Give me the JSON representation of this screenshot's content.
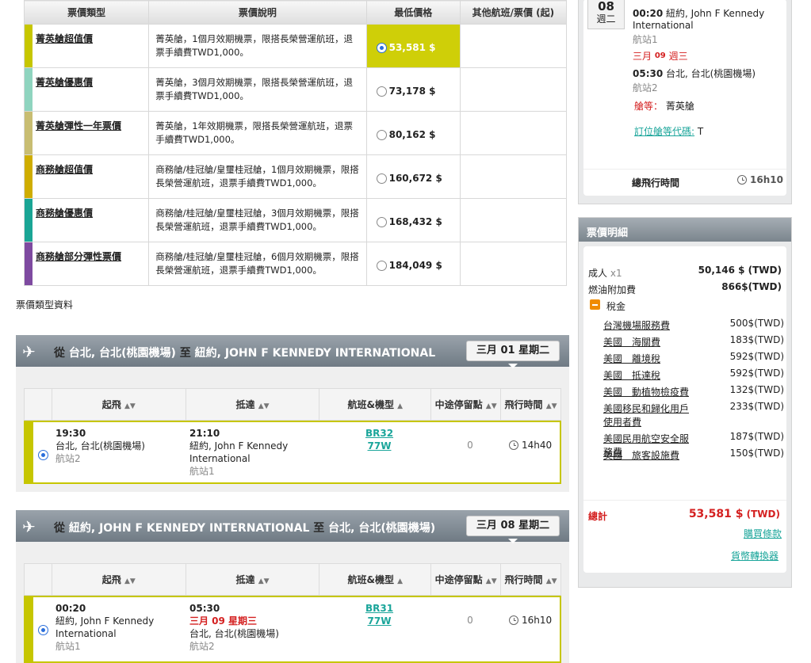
{
  "fare_table": {
    "headers": [
      "票價類型",
      "票價說明",
      "最低價格",
      "其他航班/票價 (起)"
    ],
    "rows": [
      {
        "name": "菁英艙超值價",
        "desc": "菁英艙，1個月效期機票，限搭長榮營運航班，退票手續費TWD1,000。",
        "price": "53,581 $",
        "color": "#c6c600",
        "selected": true
      },
      {
        "name": "菁英艙優惠價",
        "desc": "菁英艙，3個月效期機票，限搭長榮營運航班，退票手續費TWD1,000。",
        "price": "73,178 $",
        "color": "#8fd4bf",
        "selected": false
      },
      {
        "name": "菁英艙彈性一年票價",
        "desc": "菁英艙，1年效期機票，限搭長榮營運航班，退票手續費TWD1,000。",
        "price": "80,162 $",
        "color": "#c8bd72",
        "selected": false
      },
      {
        "name": "商務艙超值價",
        "desc": "商務艙/桂冠艙/皇璽桂冠艙，1個月效期機票，限搭長榮營運航班，退票手續費TWD1,000。",
        "price": "160,672 $",
        "color": "#cfad00",
        "selected": false
      },
      {
        "name": "商務艙優惠價",
        "desc": "商務艙/桂冠艙/皇璽桂冠艙，3個月效期機票，限搭長榮營運航班，退票手續費TWD1,000。",
        "price": "168,432 $",
        "color": "#1aa595",
        "selected": false
      },
      {
        "name": "商務艙部分彈性票價",
        "desc": "商務艙/桂冠艙/皇璽桂冠艙，6個月效期機票，限搭長榮營運航班，退票手續費TWD1,000。",
        "price": "184,049 $",
        "color": "#7e4aa0",
        "selected": false
      }
    ],
    "footnote": "票價類型資料"
  },
  "flight_headers": [
    "起飛",
    "抵達",
    "航班&機型",
    "中途停留點",
    "飛行時間"
  ],
  "outbound": {
    "from_label": "從",
    "from": "台北, 台北(桃園機場)",
    "to_label": "至",
    "to": "紐約, JOHN F KENNEDY INTERNATIONAL",
    "date": "三月 01 星期二",
    "dep_time": "19:30",
    "dep_city": "台北, 台北(桃園機場)",
    "dep_terminal": "航站2",
    "arr_time": "21:10",
    "arr_city": "紐約, John F Kennedy International",
    "arr_terminal": "航站1",
    "flight_no": "BR32",
    "aircraft": "77W",
    "stops": "0",
    "duration": "14h40"
  },
  "inbound": {
    "from_label": "從",
    "from": "紐約, JOHN F KENNEDY INTERNATIONAL",
    "to_label": "至",
    "to": "台北, 台北(桃園機場)",
    "date": "三月 08 星期二",
    "dep_time": "00:20",
    "dep_city": "紐約, John F Kennedy International",
    "dep_terminal": "航站1",
    "arr_time": "05:30",
    "arr_date": "三月 09 星期三",
    "arr_city": "台北, 台北(桃園機場)",
    "arr_terminal": "航站2",
    "flight_no": "BR31",
    "aircraft": "77W",
    "stops": "0",
    "duration": "16h10"
  },
  "summary": {
    "day": "08",
    "weekday": "週二",
    "dep_time": "00:20",
    "dep_city": "紐約, John F Kennedy International",
    "dep_terminal": "航站1",
    "arr_date_a": "三月",
    "arr_date_b": "09",
    "arr_date_c": "週三",
    "arr_time": "05:30",
    "arr_city": "台北, 台北(桃園機場)",
    "arr_terminal": "航站2",
    "cabin_label": "艙等：",
    "cabin": "菁英艙",
    "booking_class_label": "訂位艙等代碼:",
    "booking_class": "T",
    "total_time_label": "總飛行時間",
    "total_time": "16h10"
  },
  "price_detail": {
    "title": "票價明細",
    "adult_label": "成人",
    "adult_count": "x1",
    "adult_value": "50,146 $ (TWD)",
    "fuel_label": "燃油附加費",
    "fuel_value": "866$(TWD)",
    "tax_label": "稅金",
    "taxes": [
      {
        "name": "台灣機場服務費",
        "value": "500$(TWD)"
      },
      {
        "name": "美國　海關費",
        "value": "183$(TWD)"
      },
      {
        "name": "美國　離境稅",
        "value": "592$(TWD)"
      },
      {
        "name": "美國　抵達稅",
        "value": "592$(TWD)"
      },
      {
        "name": "美國　動植物檢疫費",
        "value": "132$(TWD)"
      },
      {
        "name": "美國移民和歸化用戶使用者費",
        "value": "233$(TWD)"
      },
      {
        "name": "美國民用航空安全服務費",
        "value": "187$(TWD)"
      },
      {
        "name": "美國　旅客設施費",
        "value": "150$(TWD)"
      }
    ],
    "total_label": "總計",
    "total_value": "53,581 $",
    "total_currency": "(TWD)",
    "purchase_terms": "購買條款",
    "currency_convert": "貨幣轉換器"
  },
  "colors": {
    "selected": "#c6c600",
    "accent": "#1aa59a",
    "red": "#d42020"
  }
}
